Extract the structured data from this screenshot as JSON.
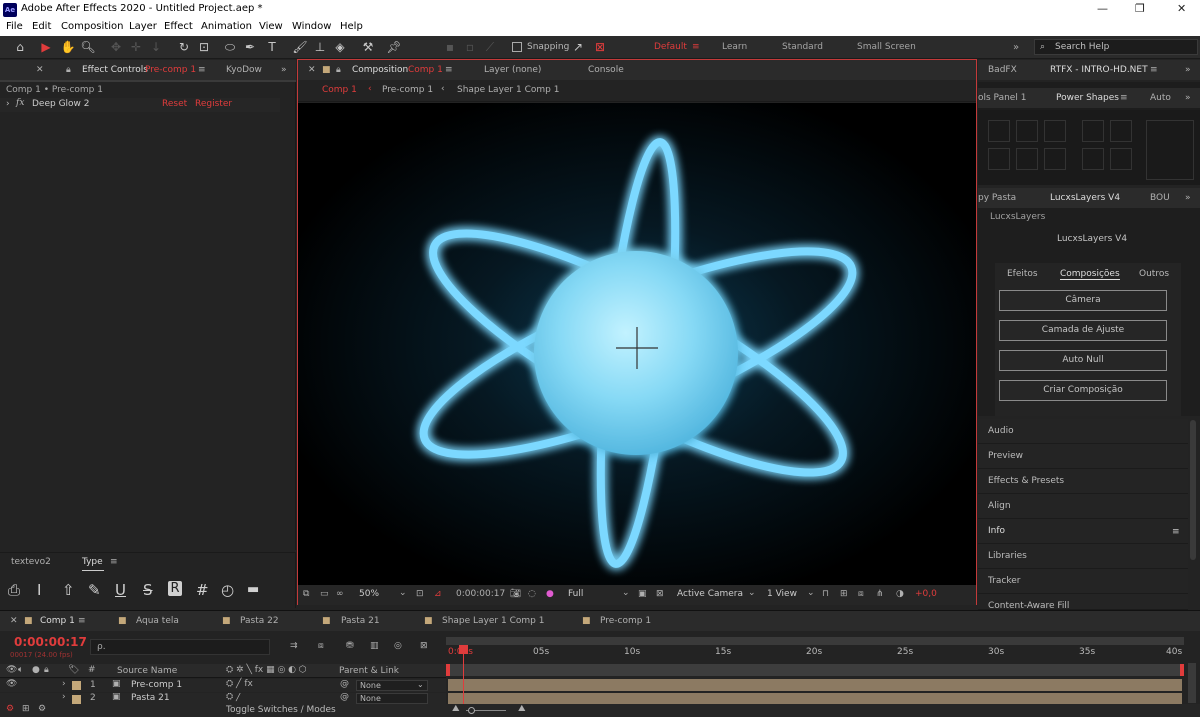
{
  "window": {
    "app_icon": "Ae",
    "title": "Adobe After Effects 2020 - Untitled Project.aep *"
  },
  "menu": [
    "File",
    "Edit",
    "Composition",
    "Layer",
    "Effect",
    "Animation",
    "View",
    "Window",
    "Help"
  ],
  "toolbar": {
    "snapping_label": "Snapping",
    "workspaces": [
      "Default",
      "Learn",
      "Standard",
      "Small Screen"
    ],
    "active_workspace": "Default",
    "search_placeholder": "Search Help"
  },
  "effect_controls": {
    "tab_label": "Effect Controls",
    "tab_target": "Pre-comp 1",
    "other_tab": "KyoDow",
    "breadcrumb": "Comp 1 • Pre-comp 1",
    "effect_name": "Deep Glow 2",
    "reset_label": "Reset",
    "register_label": "Register"
  },
  "type_panel": {
    "tabs": [
      "textevo2",
      "Type"
    ],
    "icons": [
      "tt-icon",
      "cursor-icon",
      "arrow-up-icon",
      "pen-icon",
      "underline-icon",
      "strikethrough-icon",
      "registered-icon",
      "hash-icon",
      "timer-icon",
      "ruler-icon"
    ],
    "glyphs": [
      "⎙",
      "I",
      "⇧",
      "✎",
      "U",
      "S",
      "R",
      "#",
      "◴",
      "▬"
    ]
  },
  "composition": {
    "tab_label": "Composition",
    "tab_target": "Comp 1",
    "layer_tab": "Layer (none)",
    "console_tab": "Console",
    "flow": [
      "Comp 1",
      "Pre-comp 1",
      "Shape Layer 1 Comp 1"
    ],
    "zoom": "50%",
    "timecode": "0:00:00:17",
    "resolution": "Full",
    "camera": "Active Camera",
    "views": "1 View",
    "exposure": "+0,0"
  },
  "right_panels": {
    "tabs_top": [
      "BadFX",
      "RTFX - INTRO-HD.NET"
    ],
    "tabs_mid": [
      "ols Panel 1",
      "Power Shapes",
      "Auto"
    ],
    "tabs_lucx": [
      "py Pasta",
      "LucxsLayers V4",
      "BOU"
    ],
    "lucx_header": "LucxsLayers",
    "lucx_title": "LucxsLayers V4",
    "lucx_tabs": [
      "Efeitos",
      "Composições",
      "Outros"
    ],
    "lucx_active_tab": "Composições",
    "lucx_buttons": [
      "Câmera",
      "Camada de Ajuste",
      "Auto Null",
      "Criar Composição"
    ],
    "stack": [
      "Audio",
      "Preview",
      "Effects & Presets",
      "Align",
      "Info",
      "Libraries",
      "Tracker",
      "Content-Aware Fill"
    ]
  },
  "timeline": {
    "tabs": [
      "Comp 1",
      "Aqua tela",
      "Pasta 22",
      "Pasta 21",
      "Shape Layer 1 Comp 1",
      "Pre-comp 1"
    ],
    "active_tab": "Comp 1",
    "timecode": "0:00:00:17",
    "frame_info": "00017 (24.00 fps)",
    "search_placeholder": "ρ.",
    "ruler": [
      "0:00s",
      "05s",
      "10s",
      "15s",
      "20s",
      "25s",
      "30s",
      "35s",
      "40s"
    ],
    "columns": {
      "source_name": "Source Name",
      "parent": "Parent & Link"
    },
    "layers": [
      {
        "num": "1",
        "name": "Pre-comp 1",
        "parent": "None"
      },
      {
        "num": "2",
        "name": "Pasta 21",
        "parent": "None"
      }
    ],
    "toggle_label": "Toggle Switches / Modes",
    "duration_seconds": 40,
    "playhead_seconds": 0.71
  },
  "colors": {
    "accent_red": "#e03c3c",
    "glow": "#67d4ff",
    "panel_bg": "#232323"
  }
}
